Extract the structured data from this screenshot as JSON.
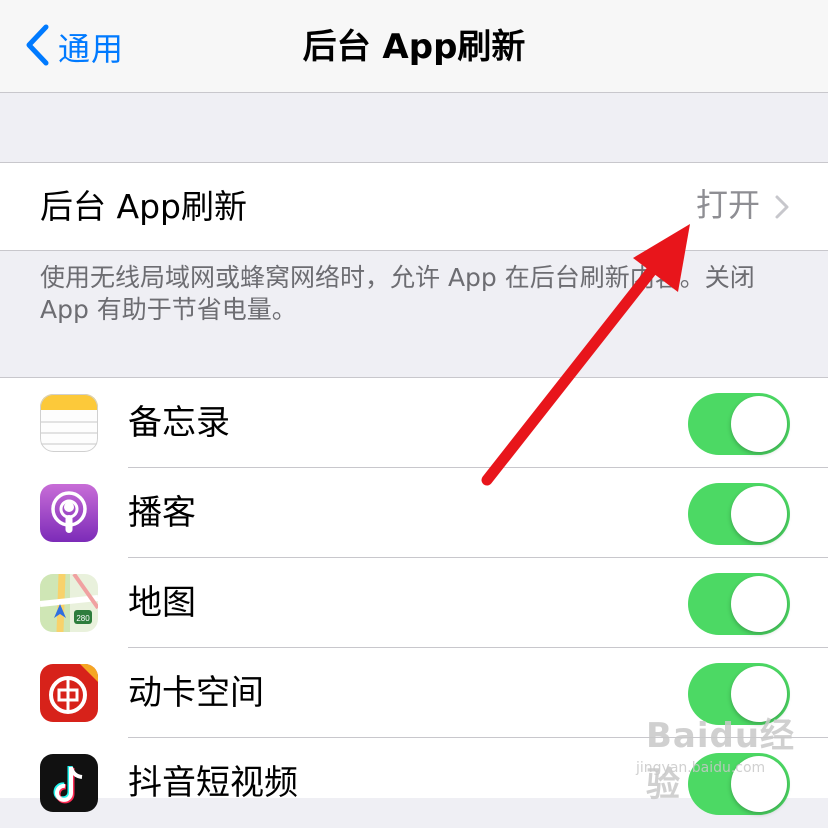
{
  "navbar": {
    "back_label": "通用",
    "title": "后台 App刷新"
  },
  "refresh_setting": {
    "label": "后台 App刷新",
    "value": "打开"
  },
  "footer": {
    "text": "使用无线局域网或蜂窝网络时，允许 App 在后台刷新内容。关闭 App 有助于节省电量。"
  },
  "apps": [
    {
      "name": "备忘录",
      "icon": "notes-app-icon",
      "enabled": true
    },
    {
      "name": "播客",
      "icon": "podcasts-app-icon",
      "enabled": true
    },
    {
      "name": "地图",
      "icon": "maps-app-icon",
      "enabled": true
    },
    {
      "name": "动卡空间",
      "icon": "citic-card-app-icon",
      "enabled": true
    },
    {
      "name": "抖音短视频",
      "icon": "douyin-app-icon",
      "enabled": true
    }
  ],
  "watermark": {
    "brand": "Baidu经验",
    "url": "jingyan.baidu.com"
  },
  "colors": {
    "accent": "#007aff",
    "toggle_on": "#4cd964",
    "annotation_arrow": "#e8151b"
  }
}
